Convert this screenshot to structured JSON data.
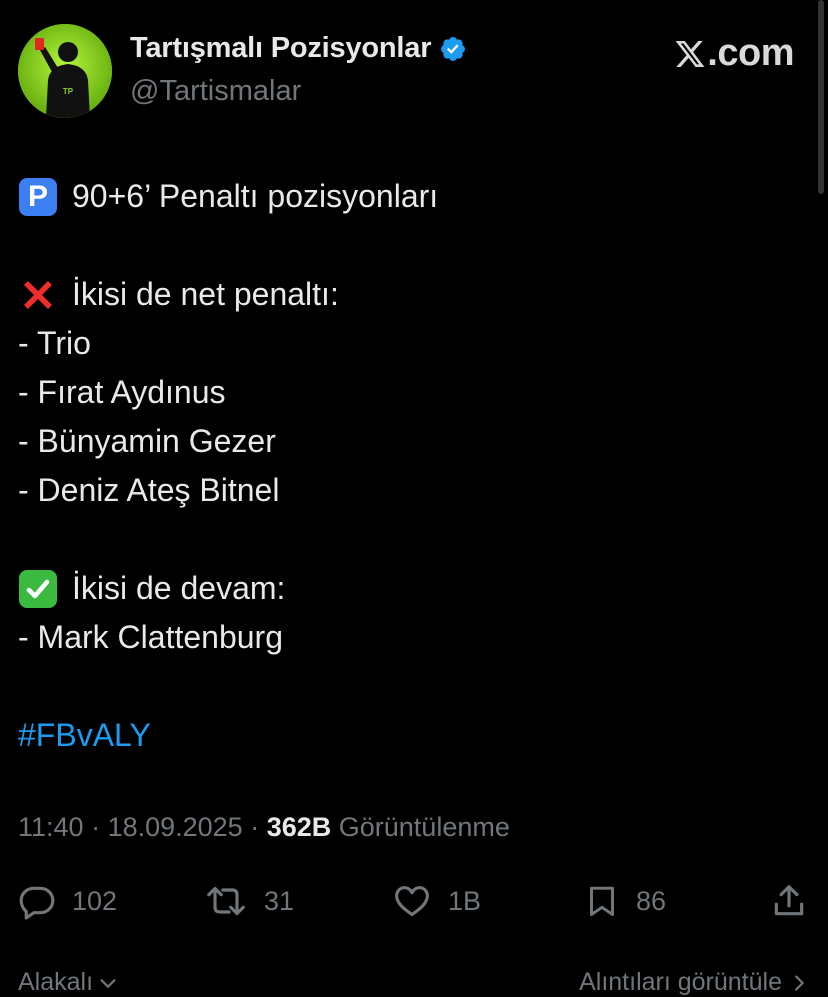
{
  "author": {
    "display_name": "Tartışmalı Pozisyonlar",
    "handle": "@Tartismalar",
    "avatar_text": "TP",
    "verified": true
  },
  "watermark": {
    "domain": ".com",
    "logo": "x-logo-icon"
  },
  "tweet": {
    "lines": [
      "90+6’ Penaltı pozisyonları",
      "İkisi de net penaltı:",
      "- Trio",
      "- Fırat Aydınus",
      "- Bünyamin Gezer",
      "- Deniz Ateş Bitnel",
      "İkisi de devam:",
      "- Mark Clattenburg"
    ],
    "hashtag": "#FBvALY",
    "emojis": [
      "p-button-emoji",
      "cross-mark-emoji",
      "check-mark-emoji"
    ]
  },
  "meta": {
    "time": "11:40",
    "separator": " · ",
    "date": "18.09.2025",
    "views_count": "362B",
    "views_label": "Görüntülenme"
  },
  "actions": {
    "replies": "102",
    "reposts": "31",
    "likes": "1B",
    "bookmarks": "86"
  },
  "footer": {
    "relevant_label": "Alakalı",
    "quotes_label": "Alıntıları görüntüle"
  },
  "colors": {
    "background": "#000000",
    "text": "#e7e9ea",
    "secondary": "#71767b",
    "link": "#1d9bf0",
    "verified": "#1d9bf0"
  }
}
